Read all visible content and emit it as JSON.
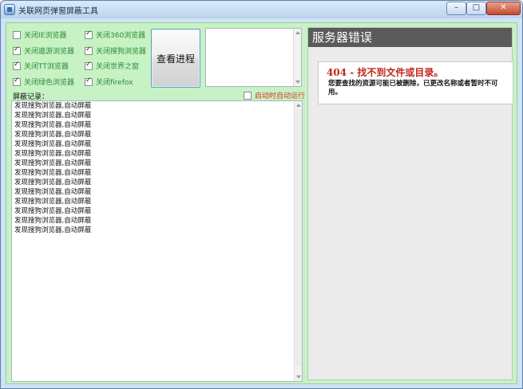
{
  "window": {
    "title": "关联网页弹窗屏蔽工具",
    "minimize_glyph": "–",
    "maximize_glyph": "□",
    "close_glyph": "✕"
  },
  "options": [
    {
      "label": "关闭IE浏览器",
      "checked": false
    },
    {
      "label": "关闭360浏览器",
      "checked": true
    },
    {
      "label": "关闭遨游浏览器",
      "checked": true
    },
    {
      "label": "关闭搜狗浏览器",
      "checked": true
    },
    {
      "label": "关闭TT浏览器",
      "checked": true
    },
    {
      "label": "关闭世界之窗",
      "checked": true
    },
    {
      "label": "关闭绿色浏览器",
      "checked": true
    },
    {
      "label": "关闭firefox",
      "checked": true
    }
  ],
  "view_process_button": "查看进程",
  "log": {
    "label": "屏蔽记录：",
    "autorun_label": "启动时自动运行",
    "autorun_checked": false,
    "lines": [
      "发现搜狗浏览器,自动屏蔽",
      "发现搜狗浏览器,自动屏蔽",
      "发现搜狗浏览器,自动屏蔽",
      "发现搜狗浏览器,自动屏蔽",
      "发现搜狗浏览器,自动屏蔽",
      "发现搜狗浏览器,自动屏蔽",
      "发现搜狗浏览器,自动屏蔽",
      "发现搜狗浏览器,自动屏蔽",
      "发现搜狗浏览器,自动屏蔽",
      "发现搜狗浏览器,自动屏蔽",
      "发现搜狗浏览器,自动屏蔽",
      "发现搜狗浏览器,自动屏蔽",
      "发现搜狗浏览器,自动屏蔽",
      "发现搜狗浏览器,自动屏蔽"
    ]
  },
  "web_panel": {
    "header": "服务器错误",
    "error_title": "404 - 找不到文件或目录。",
    "error_message": "您要查找的资源可能已被删除，已更改名称或者暂时不可用。"
  },
  "colors": {
    "client_bg": "#c7f2c4",
    "checkbox_text": "#2e8b3a",
    "autorun_text": "#d63a26",
    "error_header_bg": "#5a5a5a",
    "error_title": "#c0271a"
  }
}
